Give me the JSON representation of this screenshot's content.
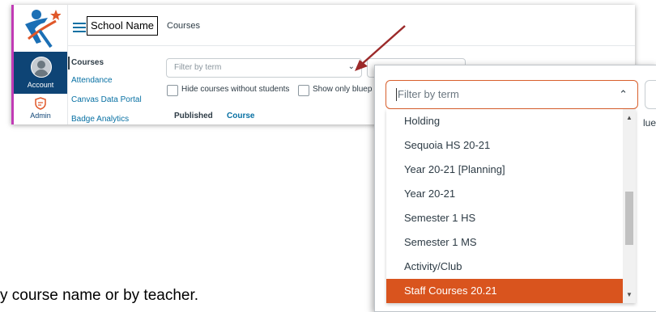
{
  "header": {
    "school_name": "School Name",
    "breadcrumb": "Courses"
  },
  "global_nav": {
    "account_label": "Account",
    "admin_label": "Admin"
  },
  "sub_nav": {
    "items": [
      "Courses",
      "Attendance",
      "Canvas Data Portal",
      "Badge Analytics"
    ]
  },
  "filters": {
    "term_placeholder": "Filter by term",
    "hide_without_students": "Hide courses without students",
    "show_only_blueprint": "Show only bluep"
  },
  "table": {
    "columns": [
      "Published",
      "Course"
    ]
  },
  "zoom": {
    "input_placeholder": "Filter by term",
    "side_fragment": "luep",
    "options": [
      "Holding",
      "Sequoia HS 20-21",
      "Year 20-21 [Planning]",
      "Year 20-21",
      "Semester 1 HS",
      "Semester 1 MS",
      "Activity/Club",
      "Staff Courses 20.21"
    ],
    "selected": "Staff Courses 20.21"
  },
  "caption": "y course name or by teacher.",
  "colors": {
    "canvas_nav": "#0e4475",
    "highlight": "#d9541e",
    "link": "#0770a3",
    "arrow": "#9c2a2a"
  }
}
